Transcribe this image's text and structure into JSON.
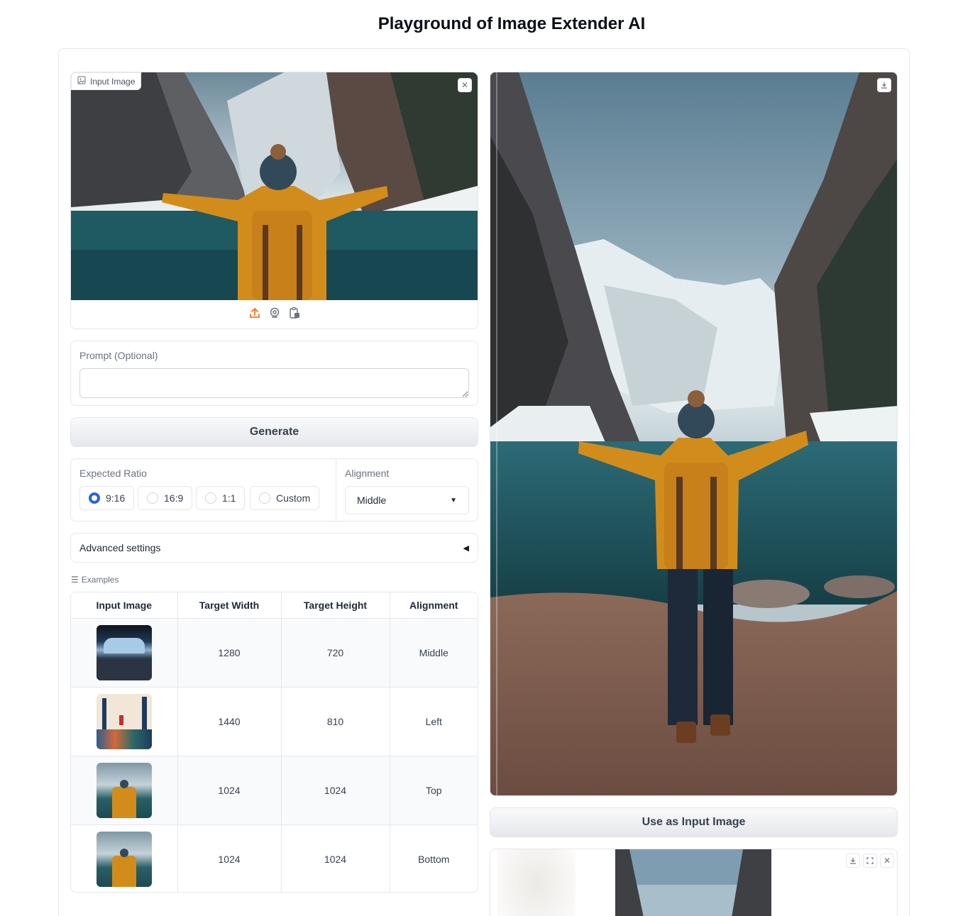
{
  "title": "Playground of Image Extender AI",
  "input_image": {
    "label": "Input Image",
    "clear_icon": "close-icon",
    "source_icons": [
      "upload-icon",
      "webcam-icon",
      "clipboard-icon"
    ]
  },
  "prompt": {
    "label": "Prompt (Optional)",
    "value": "",
    "placeholder": ""
  },
  "generate_label": "Generate",
  "ratio": {
    "label": "Expected Ratio",
    "options": [
      "9:16",
      "16:9",
      "1:1",
      "Custom"
    ],
    "selected": "9:16"
  },
  "alignment": {
    "label": "Alignment",
    "value": "Middle"
  },
  "advanced_label": "Advanced settings",
  "examples": {
    "label": "Examples",
    "headers": [
      "Input Image",
      "Target Width",
      "Target Height",
      "Alignment"
    ],
    "rows": [
      {
        "thumb": "spaceship-cockpit",
        "width": "1280",
        "height": "720",
        "alignment": "Middle"
      },
      {
        "thumb": "forest-illustration",
        "width": "1440",
        "height": "810",
        "alignment": "Left"
      },
      {
        "thumb": "hiker-river",
        "width": "1024",
        "height": "1024",
        "alignment": "Top"
      },
      {
        "thumb": "hiker-river",
        "width": "1024",
        "height": "1024",
        "alignment": "Bottom"
      }
    ]
  },
  "output": {
    "download_icon": "download-icon"
  },
  "use_as_input_label": "Use as Input Image",
  "gallery": {
    "icons": [
      "download-icon",
      "fullscreen-icon",
      "close-icon"
    ]
  },
  "colors": {
    "accent": "#2563eb",
    "upload": "#f97316",
    "jacket": "#d8921c"
  }
}
